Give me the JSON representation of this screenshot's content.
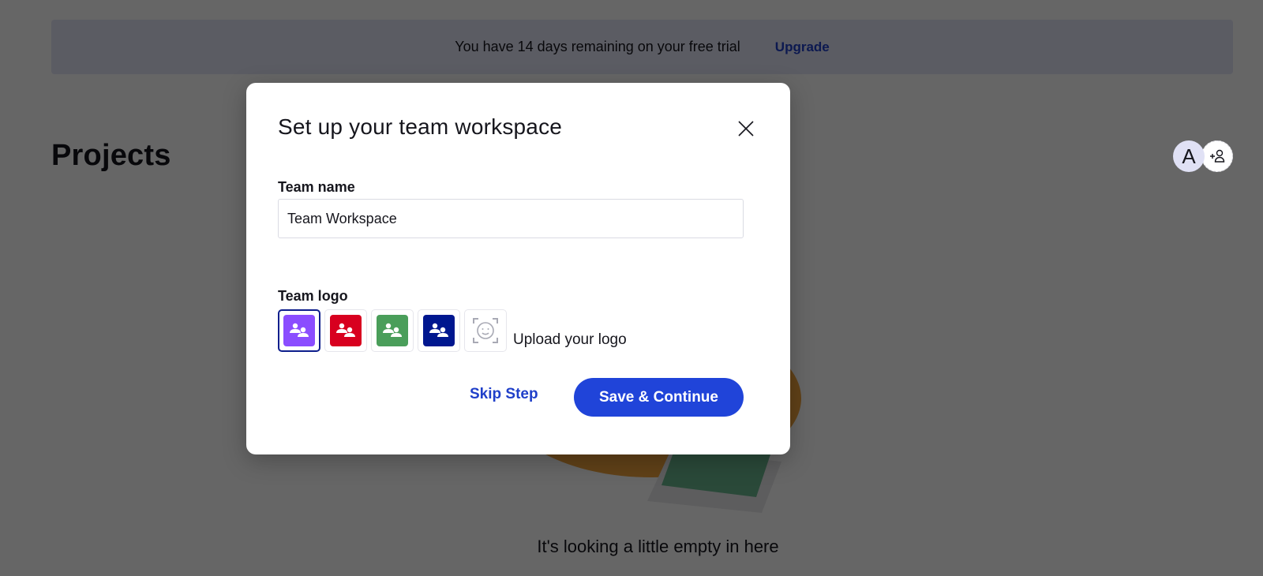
{
  "banner": {
    "message": "You have 14 days remaining on your free trial",
    "upgrade_label": "Upgrade"
  },
  "page": {
    "title": "Projects",
    "avatar_initial": "A",
    "add_member_icon": "+👤",
    "empty_state_text": "It's looking a little empty in here"
  },
  "modal": {
    "title": "Set up your team workspace",
    "close_icon": "close-icon",
    "team_name_label": "Team name",
    "team_name_value": "Team Workspace",
    "team_logo_label": "Team logo",
    "logo_options": [
      {
        "name": "purple",
        "color": "#8b4dff",
        "selected": true
      },
      {
        "name": "red",
        "color": "#d8001f",
        "selected": false
      },
      {
        "name": "green",
        "color": "#4a9e5a",
        "selected": false
      },
      {
        "name": "navy",
        "color": "#00178f",
        "selected": false
      }
    ],
    "upload_label": "Upload your logo",
    "skip_label": "Skip Step",
    "save_label": "Save & Continue"
  },
  "colors": {
    "accent": "#2044d9",
    "link": "#1f3fc9",
    "selected_border": "#0d1e8c",
    "banner_bg": "#e4e5f7"
  }
}
